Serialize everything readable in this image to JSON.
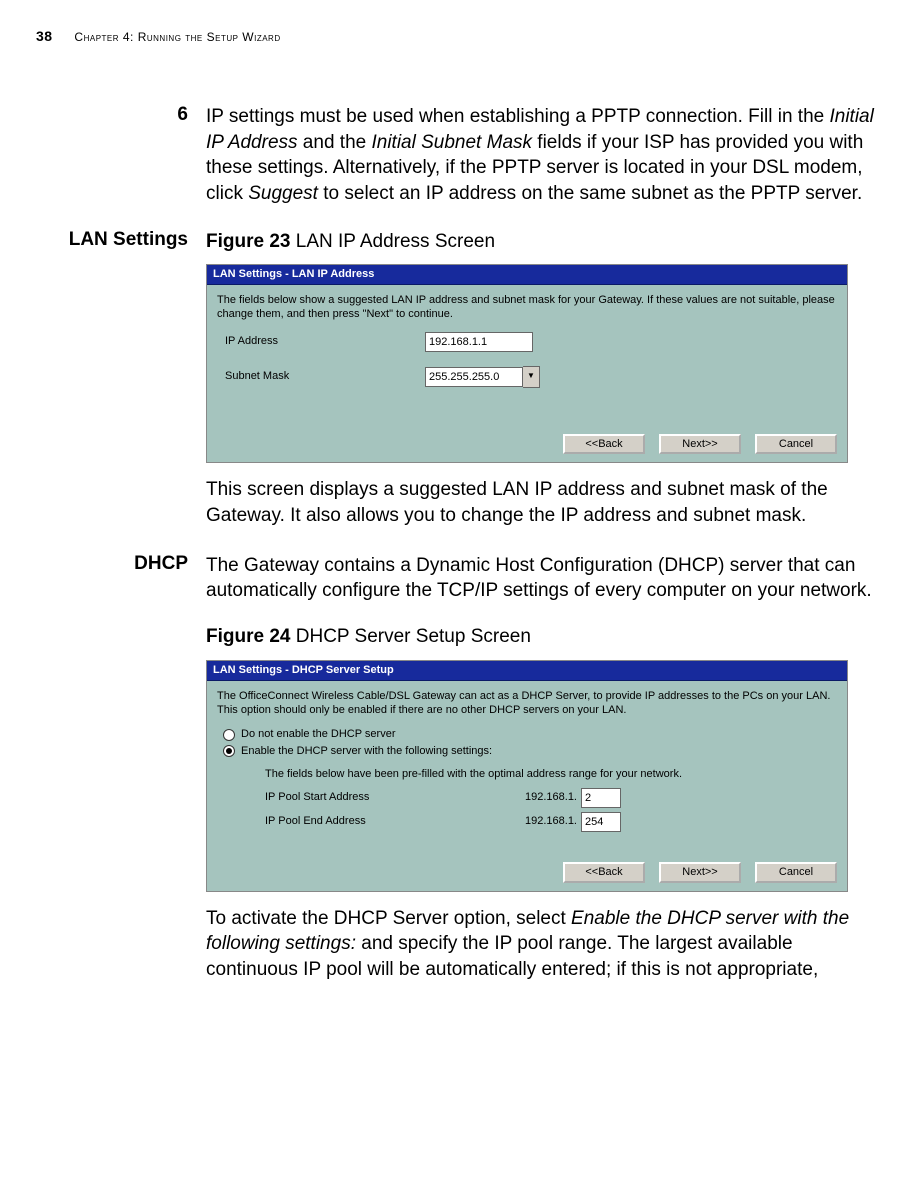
{
  "page": {
    "number": "38",
    "chapter": "Chapter 4: Running the Setup Wizard"
  },
  "step6": {
    "num": "6",
    "text_a": "IP settings must be used when establishing a PPTP connection. Fill in the ",
    "italic1": "Initial IP Address",
    "text_b": " and the ",
    "italic2": "Initial Subnet Mask",
    "text_c": " fields if your ISP has provided you with these settings. Alternatively, if the PPTP server is located in your DSL modem, click ",
    "italic3": "Suggest",
    "text_d": " to select an IP address on the same subnet as the PPTP server."
  },
  "lan": {
    "heading": "LAN Settings",
    "fig_label": "Figure 23",
    "fig_title": "   LAN IP Address Screen",
    "below": "This screen displays a suggested LAN IP address and subnet mask of the Gateway. It also allows you to change the IP address and subnet mask."
  },
  "dhcp": {
    "heading": "DHCP",
    "intro": "The Gateway contains a Dynamic Host Configuration (DHCP) server that can automatically configure the TCP/IP settings of every computer on your network.",
    "fig_label": "Figure 24",
    "fig_title": "   DHCP Server Setup Screen",
    "after_a": "To activate the DHCP Server option, select ",
    "after_i": "Enable the DHCP server with the following settings:",
    "after_b": " and specify the IP pool range. The largest available continuous IP pool will be automatically entered; if this is not appropriate,"
  },
  "shot1": {
    "title": "LAN Settings - LAN IP Address",
    "intro": "The fields below show a suggested LAN IP address and subnet mask for your Gateway. If these values are not suitable, please change them, and then press \"Next\" to continue.",
    "ip_label": "IP Address",
    "ip_value": "192.168.1.1",
    "mask_label": "Subnet Mask",
    "mask_value": "255.255.255.0",
    "back": "<<Back",
    "next": "Next>>",
    "cancel": "Cancel"
  },
  "shot2": {
    "title": "LAN Settings - DHCP Server Setup",
    "intro": "The OfficeConnect Wireless Cable/DSL Gateway can act as a DHCP Server, to provide IP addresses to the PCs on your LAN. This option should only be enabled if there are no other DHCP servers on your LAN.",
    "radio_off": "Do not enable the DHCP server",
    "radio_on": "Enable the DHCP server with the following settings:",
    "note": "The fields below have been pre-filled with the optimal address range for your network.",
    "start_label": "IP Pool Start Address",
    "end_label": "IP Pool End Address",
    "prefix": "192.168.1.",
    "start_value": "2",
    "end_value": "254",
    "back": "<<Back",
    "next": "Next>>",
    "cancel": "Cancel"
  }
}
